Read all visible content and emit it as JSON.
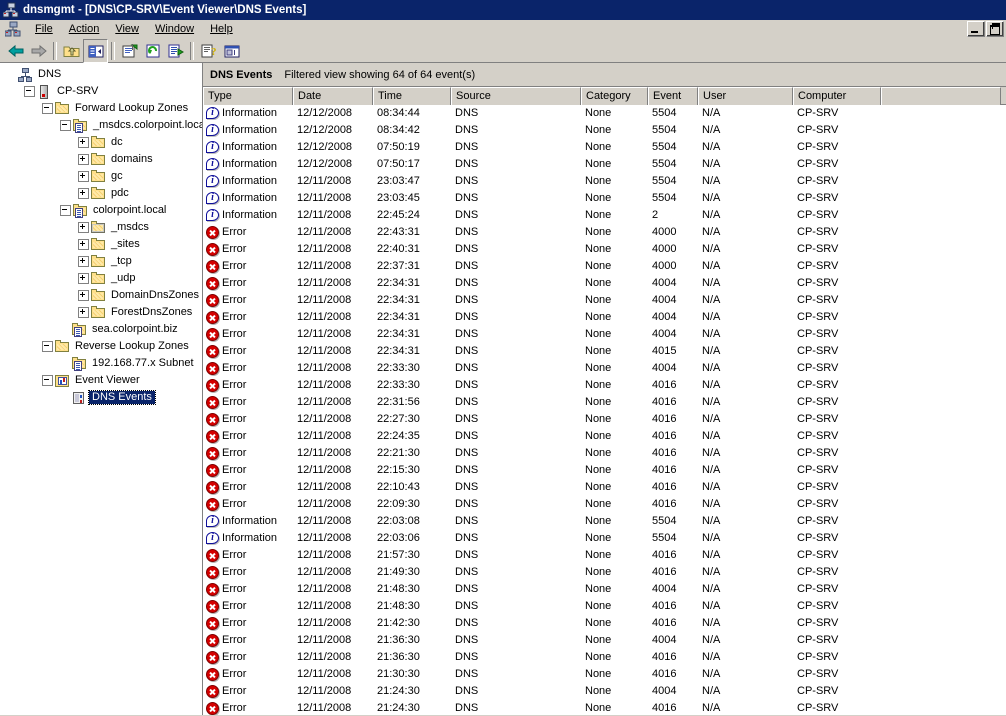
{
  "window": {
    "title": "dnsmgmt - [DNS\\CP-SRV\\Event Viewer\\DNS Events]",
    "title_icon": "dns-console-icon",
    "mdi_minimize_label": "_",
    "mdi_restore_label": "❐"
  },
  "menu": {
    "icon": "console-icon",
    "items": [
      {
        "label": "File"
      },
      {
        "label": "Action"
      },
      {
        "label": "View"
      },
      {
        "label": "Window"
      },
      {
        "label": "Help"
      }
    ]
  },
  "toolbar": {
    "buttons": [
      {
        "name": "back-button",
        "icon": "back-arrow-icon",
        "pressed": false
      },
      {
        "name": "forward-button",
        "icon": "forward-arrow-icon",
        "pressed": false
      },
      {
        "name": "separator-1",
        "icon": "separator",
        "pressed": false
      },
      {
        "name": "up-one-level-button",
        "icon": "folder-up-icon",
        "pressed": false
      },
      {
        "name": "show-hide-tree-button",
        "icon": "show-tree-icon",
        "pressed": true
      },
      {
        "name": "separator-2",
        "icon": "separator",
        "pressed": false
      },
      {
        "name": "properties-button",
        "icon": "properties-icon",
        "pressed": false
      },
      {
        "name": "refresh-button",
        "icon": "refresh-icon",
        "pressed": false
      },
      {
        "name": "export-list-button",
        "icon": "export-list-icon",
        "pressed": false
      },
      {
        "name": "separator-3",
        "icon": "separator",
        "pressed": false
      },
      {
        "name": "help-button",
        "icon": "help-icon",
        "pressed": false
      },
      {
        "name": "new-window-button",
        "icon": "new-window-icon",
        "pressed": false
      }
    ]
  },
  "tree": {
    "nodes": [
      {
        "label": "DNS",
        "depth": 0,
        "icon": "dns-root-icon",
        "expander": "none",
        "selected": false
      },
      {
        "label": "CP-SRV",
        "depth": 1,
        "icon": "server-icon",
        "expander": "minus",
        "selected": false
      },
      {
        "label": "Forward Lookup Zones",
        "depth": 2,
        "icon": "folder-icon",
        "expander": "minus",
        "selected": false
      },
      {
        "label": "_msdcs.colorpoint.local",
        "depth": 3,
        "icon": "zone-icon",
        "expander": "minus",
        "selected": false
      },
      {
        "label": "dc",
        "depth": 4,
        "icon": "folder-icon",
        "expander": "plus",
        "selected": false
      },
      {
        "label": "domains",
        "depth": 4,
        "icon": "folder-icon",
        "expander": "plus",
        "selected": false
      },
      {
        "label": "gc",
        "depth": 4,
        "icon": "folder-icon",
        "expander": "plus",
        "selected": false
      },
      {
        "label": "pdc",
        "depth": 4,
        "icon": "folder-icon",
        "expander": "plus",
        "selected": false
      },
      {
        "label": "colorpoint.local",
        "depth": 3,
        "icon": "zone-icon",
        "expander": "minus",
        "selected": false
      },
      {
        "label": "_msdcs",
        "depth": 4,
        "icon": "folder-grey-icon",
        "expander": "plus",
        "selected": false
      },
      {
        "label": "_sites",
        "depth": 4,
        "icon": "folder-icon",
        "expander": "plus",
        "selected": false
      },
      {
        "label": "_tcp",
        "depth": 4,
        "icon": "folder-icon",
        "expander": "plus",
        "selected": false
      },
      {
        "label": "_udp",
        "depth": 4,
        "icon": "folder-icon",
        "expander": "plus",
        "selected": false
      },
      {
        "label": "DomainDnsZones",
        "depth": 4,
        "icon": "folder-icon",
        "expander": "plus",
        "selected": false
      },
      {
        "label": "ForestDnsZones",
        "depth": 4,
        "icon": "folder-icon",
        "expander": "plus",
        "selected": false
      },
      {
        "label": "sea.colorpoint.biz",
        "depth": 3,
        "icon": "zone-icon",
        "expander": "none",
        "selected": false
      },
      {
        "label": "Reverse Lookup Zones",
        "depth": 2,
        "icon": "folder-icon",
        "expander": "minus",
        "selected": false
      },
      {
        "label": "192.168.77.x Subnet",
        "depth": 3,
        "icon": "zone-icon",
        "expander": "none",
        "selected": false
      },
      {
        "label": "Event Viewer",
        "depth": 2,
        "icon": "event-viewer-icon",
        "expander": "minus",
        "selected": false
      },
      {
        "label": "DNS Events",
        "depth": 3,
        "icon": "event-log-icon",
        "expander": "none",
        "selected": true
      }
    ]
  },
  "view_header": {
    "title": "DNS Events",
    "status": "Filtered view showing 64 of 64 event(s)"
  },
  "table": {
    "columns": [
      {
        "label": "Type",
        "width": 90
      },
      {
        "label": "Date",
        "width": 80
      },
      {
        "label": "Time",
        "width": 78
      },
      {
        "label": "Source",
        "width": 130
      },
      {
        "label": "Category",
        "width": 67
      },
      {
        "label": "Event",
        "width": 50
      },
      {
        "label": "User",
        "width": 95
      },
      {
        "label": "Computer",
        "width": 88
      },
      {
        "label": "",
        "width": 120
      }
    ],
    "rows": [
      {
        "type": "Information",
        "icon": "information-icon",
        "date": "12/12/2008",
        "time": "08:34:44",
        "source": "DNS",
        "category": "None",
        "event": "5504",
        "user": "N/A",
        "computer": "CP-SRV"
      },
      {
        "type": "Information",
        "icon": "information-icon",
        "date": "12/12/2008",
        "time": "08:34:42",
        "source": "DNS",
        "category": "None",
        "event": "5504",
        "user": "N/A",
        "computer": "CP-SRV"
      },
      {
        "type": "Information",
        "icon": "information-icon",
        "date": "12/12/2008",
        "time": "07:50:19",
        "source": "DNS",
        "category": "None",
        "event": "5504",
        "user": "N/A",
        "computer": "CP-SRV"
      },
      {
        "type": "Information",
        "icon": "information-icon",
        "date": "12/12/2008",
        "time": "07:50:17",
        "source": "DNS",
        "category": "None",
        "event": "5504",
        "user": "N/A",
        "computer": "CP-SRV"
      },
      {
        "type": "Information",
        "icon": "information-icon",
        "date": "12/11/2008",
        "time": "23:03:47",
        "source": "DNS",
        "category": "None",
        "event": "5504",
        "user": "N/A",
        "computer": "CP-SRV"
      },
      {
        "type": "Information",
        "icon": "information-icon",
        "date": "12/11/2008",
        "time": "23:03:45",
        "source": "DNS",
        "category": "None",
        "event": "5504",
        "user": "N/A",
        "computer": "CP-SRV"
      },
      {
        "type": "Information",
        "icon": "information-icon",
        "date": "12/11/2008",
        "time": "22:45:24",
        "source": "DNS",
        "category": "None",
        "event": "2",
        "user": "N/A",
        "computer": "CP-SRV"
      },
      {
        "type": "Error",
        "icon": "error-icon",
        "date": "12/11/2008",
        "time": "22:43:31",
        "source": "DNS",
        "category": "None",
        "event": "4000",
        "user": "N/A",
        "computer": "CP-SRV"
      },
      {
        "type": "Error",
        "icon": "error-icon",
        "date": "12/11/2008",
        "time": "22:40:31",
        "source": "DNS",
        "category": "None",
        "event": "4000",
        "user": "N/A",
        "computer": "CP-SRV"
      },
      {
        "type": "Error",
        "icon": "error-icon",
        "date": "12/11/2008",
        "time": "22:37:31",
        "source": "DNS",
        "category": "None",
        "event": "4000",
        "user": "N/A",
        "computer": "CP-SRV"
      },
      {
        "type": "Error",
        "icon": "error-icon",
        "date": "12/11/2008",
        "time": "22:34:31",
        "source": "DNS",
        "category": "None",
        "event": "4004",
        "user": "N/A",
        "computer": "CP-SRV"
      },
      {
        "type": "Error",
        "icon": "error-icon",
        "date": "12/11/2008",
        "time": "22:34:31",
        "source": "DNS",
        "category": "None",
        "event": "4004",
        "user": "N/A",
        "computer": "CP-SRV"
      },
      {
        "type": "Error",
        "icon": "error-icon",
        "date": "12/11/2008",
        "time": "22:34:31",
        "source": "DNS",
        "category": "None",
        "event": "4004",
        "user": "N/A",
        "computer": "CP-SRV"
      },
      {
        "type": "Error",
        "icon": "error-icon",
        "date": "12/11/2008",
        "time": "22:34:31",
        "source": "DNS",
        "category": "None",
        "event": "4004",
        "user": "N/A",
        "computer": "CP-SRV"
      },
      {
        "type": "Error",
        "icon": "error-icon",
        "date": "12/11/2008",
        "time": "22:34:31",
        "source": "DNS",
        "category": "None",
        "event": "4015",
        "user": "N/A",
        "computer": "CP-SRV"
      },
      {
        "type": "Error",
        "icon": "error-icon",
        "date": "12/11/2008",
        "time": "22:33:30",
        "source": "DNS",
        "category": "None",
        "event": "4004",
        "user": "N/A",
        "computer": "CP-SRV"
      },
      {
        "type": "Error",
        "icon": "error-icon",
        "date": "12/11/2008",
        "time": "22:33:30",
        "source": "DNS",
        "category": "None",
        "event": "4016",
        "user": "N/A",
        "computer": "CP-SRV"
      },
      {
        "type": "Error",
        "icon": "error-icon",
        "date": "12/11/2008",
        "time": "22:31:56",
        "source": "DNS",
        "category": "None",
        "event": "4016",
        "user": "N/A",
        "computer": "CP-SRV"
      },
      {
        "type": "Error",
        "icon": "error-icon",
        "date": "12/11/2008",
        "time": "22:27:30",
        "source": "DNS",
        "category": "None",
        "event": "4016",
        "user": "N/A",
        "computer": "CP-SRV"
      },
      {
        "type": "Error",
        "icon": "error-icon",
        "date": "12/11/2008",
        "time": "22:24:35",
        "source": "DNS",
        "category": "None",
        "event": "4016",
        "user": "N/A",
        "computer": "CP-SRV"
      },
      {
        "type": "Error",
        "icon": "error-icon",
        "date": "12/11/2008",
        "time": "22:21:30",
        "source": "DNS",
        "category": "None",
        "event": "4016",
        "user": "N/A",
        "computer": "CP-SRV"
      },
      {
        "type": "Error",
        "icon": "error-icon",
        "date": "12/11/2008",
        "time": "22:15:30",
        "source": "DNS",
        "category": "None",
        "event": "4016",
        "user": "N/A",
        "computer": "CP-SRV"
      },
      {
        "type": "Error",
        "icon": "error-icon",
        "date": "12/11/2008",
        "time": "22:10:43",
        "source": "DNS",
        "category": "None",
        "event": "4016",
        "user": "N/A",
        "computer": "CP-SRV"
      },
      {
        "type": "Error",
        "icon": "error-icon",
        "date": "12/11/2008",
        "time": "22:09:30",
        "source": "DNS",
        "category": "None",
        "event": "4016",
        "user": "N/A",
        "computer": "CP-SRV"
      },
      {
        "type": "Information",
        "icon": "information-icon",
        "date": "12/11/2008",
        "time": "22:03:08",
        "source": "DNS",
        "category": "None",
        "event": "5504",
        "user": "N/A",
        "computer": "CP-SRV"
      },
      {
        "type": "Information",
        "icon": "information-icon",
        "date": "12/11/2008",
        "time": "22:03:06",
        "source": "DNS",
        "category": "None",
        "event": "5504",
        "user": "N/A",
        "computer": "CP-SRV"
      },
      {
        "type": "Error",
        "icon": "error-icon",
        "date": "12/11/2008",
        "time": "21:57:30",
        "source": "DNS",
        "category": "None",
        "event": "4016",
        "user": "N/A",
        "computer": "CP-SRV"
      },
      {
        "type": "Error",
        "icon": "error-icon",
        "date": "12/11/2008",
        "time": "21:49:30",
        "source": "DNS",
        "category": "None",
        "event": "4016",
        "user": "N/A",
        "computer": "CP-SRV"
      },
      {
        "type": "Error",
        "icon": "error-icon",
        "date": "12/11/2008",
        "time": "21:48:30",
        "source": "DNS",
        "category": "None",
        "event": "4004",
        "user": "N/A",
        "computer": "CP-SRV"
      },
      {
        "type": "Error",
        "icon": "error-icon",
        "date": "12/11/2008",
        "time": "21:48:30",
        "source": "DNS",
        "category": "None",
        "event": "4016",
        "user": "N/A",
        "computer": "CP-SRV"
      },
      {
        "type": "Error",
        "icon": "error-icon",
        "date": "12/11/2008",
        "time": "21:42:30",
        "source": "DNS",
        "category": "None",
        "event": "4016",
        "user": "N/A",
        "computer": "CP-SRV"
      },
      {
        "type": "Error",
        "icon": "error-icon",
        "date": "12/11/2008",
        "time": "21:36:30",
        "source": "DNS",
        "category": "None",
        "event": "4004",
        "user": "N/A",
        "computer": "CP-SRV"
      },
      {
        "type": "Error",
        "icon": "error-icon",
        "date": "12/11/2008",
        "time": "21:36:30",
        "source": "DNS",
        "category": "None",
        "event": "4016",
        "user": "N/A",
        "computer": "CP-SRV"
      },
      {
        "type": "Error",
        "icon": "error-icon",
        "date": "12/11/2008",
        "time": "21:30:30",
        "source": "DNS",
        "category": "None",
        "event": "4016",
        "user": "N/A",
        "computer": "CP-SRV"
      },
      {
        "type": "Error",
        "icon": "error-icon",
        "date": "12/11/2008",
        "time": "21:24:30",
        "source": "DNS",
        "category": "None",
        "event": "4004",
        "user": "N/A",
        "computer": "CP-SRV"
      },
      {
        "type": "Error",
        "icon": "error-icon",
        "date": "12/11/2008",
        "time": "21:24:30",
        "source": "DNS",
        "category": "None",
        "event": "4016",
        "user": "N/A",
        "computer": "CP-SRV"
      }
    ]
  },
  "colors": {
    "titlebar": "#0a246a",
    "chrome": "#d4d0c8",
    "selection": "#0a246a",
    "error": "#d40000",
    "information": "#10109a"
  }
}
